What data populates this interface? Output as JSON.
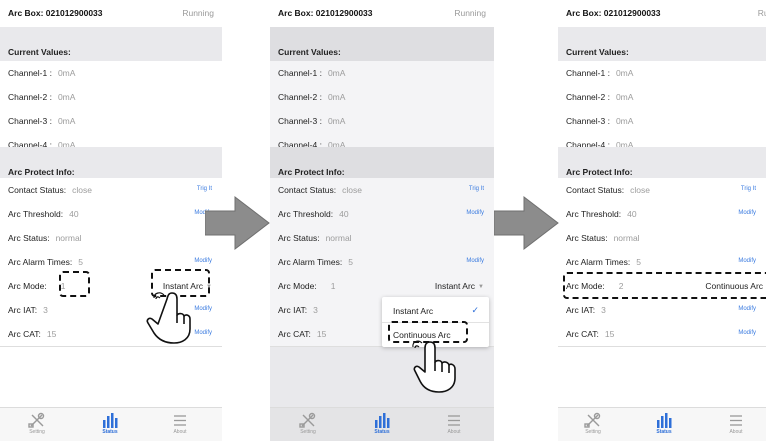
{
  "box_title": "Arc Box: 021012900033",
  "status": "Running",
  "status_cut": "Runni",
  "current_values_header": "Current Values:",
  "channels": [
    {
      "label": "Channel-1 :",
      "value": "0mA"
    },
    {
      "label": "Channel-2 :",
      "value": "0mA"
    },
    {
      "label": "Channel-3 :",
      "value": "0mA"
    },
    {
      "label": "Channel-4 :",
      "value": "0mA"
    }
  ],
  "arc_protect_header": "Arc Protect Info:",
  "contact_status": {
    "label": "Contact Status:",
    "value": "close",
    "action": "Trig It"
  },
  "arc_threshold": {
    "label": "Arc Threshold:",
    "value": "40",
    "action": "Modify"
  },
  "arc_status": {
    "label": "Arc Status:",
    "value": "normal"
  },
  "arc_alarm_times": {
    "label": "Arc Alarm Times:",
    "value": "5",
    "action": "Modify"
  },
  "arc_mode_label": "Arc Mode:",
  "arc_mode_before": {
    "value": "1",
    "selected": "Instant Arc"
  },
  "arc_mode_after": {
    "value": "2",
    "selected": "Continuous Arc"
  },
  "arc_iat": {
    "label": "Arc IAT:",
    "value": "3",
    "action": "Modify"
  },
  "arc_cat": {
    "label": "Arc CAT:",
    "value": "15",
    "action": "Modify"
  },
  "dropdown_options": [
    "Instant Arc",
    "Continuous Arc"
  ],
  "dropdown_check": "✓",
  "tabs": [
    {
      "label": "Setting",
      "icon": "tools-icon"
    },
    {
      "label": "Status",
      "icon": "bar-chart-icon"
    },
    {
      "label": "About",
      "icon": "menu-icon"
    }
  ],
  "colors": {
    "accent": "#3a7be0",
    "section_bg": "#e9e9ec",
    "arrow": "#8c8c8c"
  }
}
